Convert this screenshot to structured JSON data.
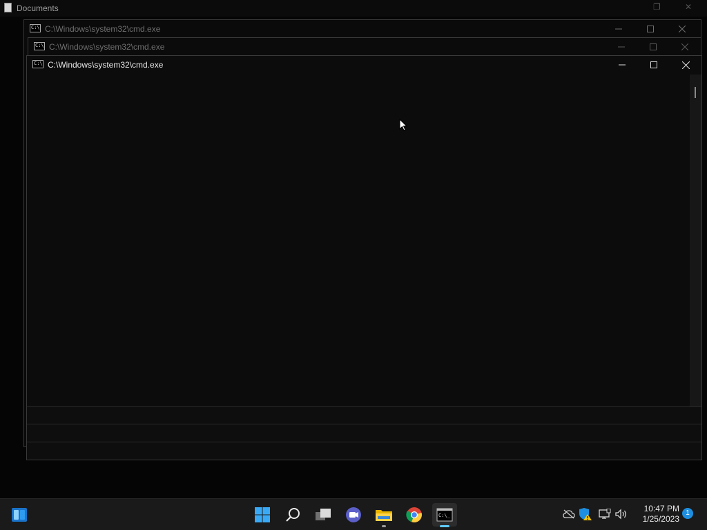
{
  "background_window": {
    "title": "Documents"
  },
  "cmd_windows": [
    {
      "title": "C:\\Windows\\system32\\cmd.exe"
    },
    {
      "title": "C:\\Windows\\system32\\cmd.exe"
    },
    {
      "title": "C:\\Windows\\system32\\cmd.exe"
    }
  ],
  "taskbar": {
    "items": [
      {
        "icon": "widgets-icon"
      },
      {
        "icon": "windows-start-icon"
      },
      {
        "icon": "search-icon"
      },
      {
        "icon": "task-view-icon"
      },
      {
        "icon": "teams-chat-icon"
      },
      {
        "icon": "file-explorer-icon"
      },
      {
        "icon": "chrome-icon"
      },
      {
        "icon": "terminal-icon"
      }
    ],
    "tray": {
      "icons": [
        "onedrive-offline-icon",
        "security-warning-icon",
        "network-icon",
        "volume-icon"
      ],
      "time": "10:47 PM",
      "date": "1/25/2023",
      "notification_count": "1"
    }
  },
  "colors": {
    "accent": "#60cdff",
    "notification": "#1e8fe0"
  }
}
